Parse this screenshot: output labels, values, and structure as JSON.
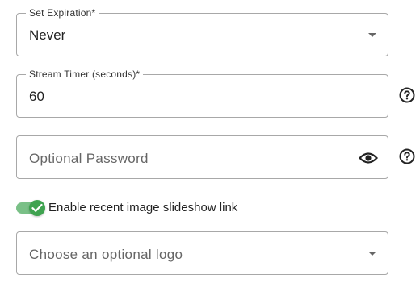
{
  "expiration": {
    "label": "Set Expiration*",
    "value": "Never"
  },
  "stream_timer": {
    "label": "Stream Timer (seconds)*",
    "value": "60"
  },
  "password": {
    "placeholder": "Optional Password"
  },
  "slideshow_toggle": {
    "label": "Enable recent image slideshow link",
    "enabled": true
  },
  "logo_select": {
    "placeholder": "Choose an optional logo"
  },
  "icons": {
    "dropdown": "chevron-down-icon",
    "visibility": "eye-icon",
    "help": "question-circle-icon",
    "check": "check-icon"
  },
  "colors": {
    "toggle_on": "#3fa350",
    "toggle_track": "#7ac087"
  }
}
